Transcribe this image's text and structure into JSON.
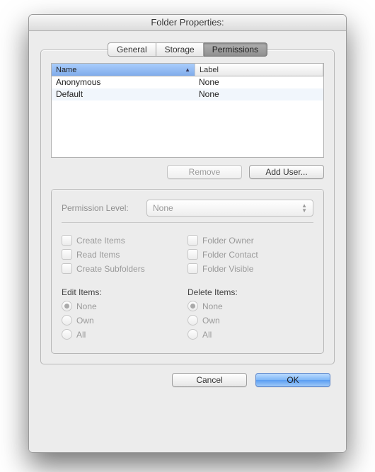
{
  "window": {
    "title": "Folder Properties:"
  },
  "tabs": {
    "items": [
      {
        "label": "General"
      },
      {
        "label": "Storage"
      },
      {
        "label": "Permissions"
      }
    ],
    "active": 2
  },
  "table": {
    "columns": {
      "name": "Name",
      "label": "Label"
    },
    "rows": [
      {
        "name": "Anonymous",
        "label": "None"
      },
      {
        "name": "Default",
        "label": "None"
      }
    ]
  },
  "buttons": {
    "remove": "Remove",
    "addUser": "Add User...",
    "cancel": "Cancel",
    "ok": "OK"
  },
  "perm": {
    "level_label": "Permission Level:",
    "level_value": "None",
    "checks_left": [
      "Create Items",
      "Read Items",
      "Create Subfolders"
    ],
    "checks_right": [
      "Folder Owner",
      "Folder Contact",
      "Folder Visible"
    ],
    "edit_head": "Edit Items:",
    "delete_head": "Delete Items:",
    "radio_options": [
      "None",
      "Own",
      "All"
    ]
  }
}
